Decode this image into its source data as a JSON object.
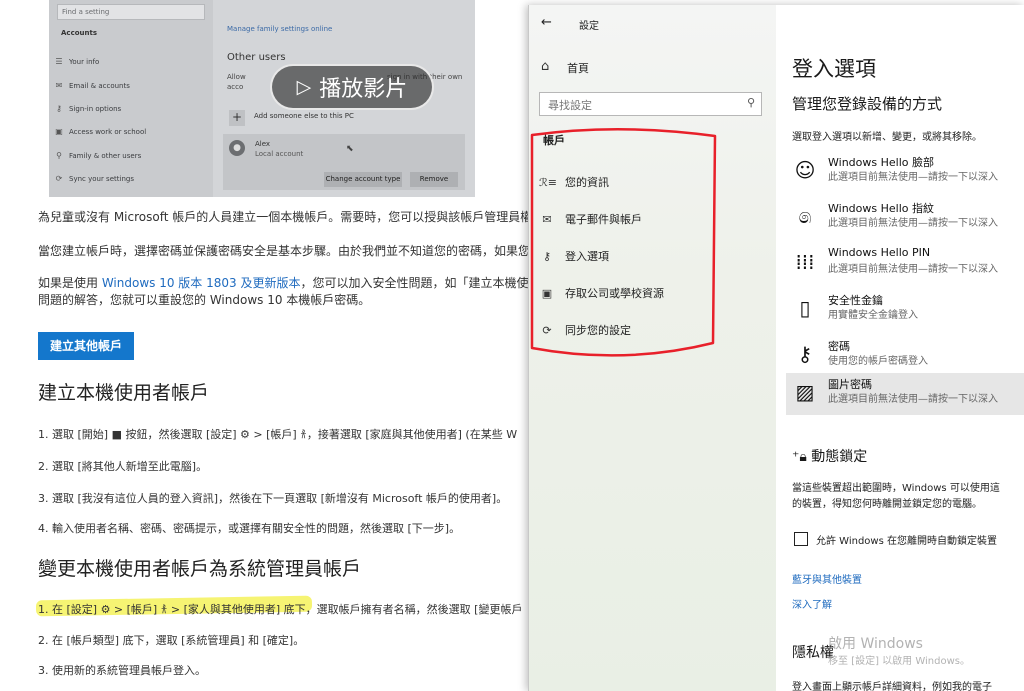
{
  "video": {
    "search_placeholder": "Find a setting",
    "section": "Accounts",
    "nav": [
      {
        "icon": "person-card-icon",
        "label": "Your info"
      },
      {
        "icon": "mail-icon",
        "label": "Email & accounts"
      },
      {
        "icon": "key-icon",
        "label": "Sign-in options"
      },
      {
        "icon": "briefcase-icon",
        "label": "Access work or school"
      },
      {
        "icon": "family-icon",
        "label": "Family & other users"
      },
      {
        "icon": "sync-icon",
        "label": "Sync your settings"
      }
    ],
    "family_link": "Manage family settings online",
    "other_users_heading": "Other users",
    "desc_left": "Allow",
    "desc_left2": "acco",
    "desc_right": "sign in with their own",
    "add_label": "Add someone else to this PC",
    "user_name": "Alex",
    "user_role": "Local account",
    "change_type_btn": "Change account type",
    "remove_btn": "Remove",
    "play_label": "播放影片"
  },
  "article": {
    "p1": "為兒童或沒有 Microsoft 帳戶的人員建立一個本機帳戶。需要時，您可以授與該帳戶管理員權限。",
    "p2": "當您建立帳戶時，選擇密碼並保護密碼安全是基本步驟。由於我們並不知道您的密碼，如果您忘記",
    "p3_pre": "如果是使用 ",
    "p3_link": "Windows 10 版本 1803 及更新版本",
    "p3_post": "，您可以加入安全性問題，如「建立本機使用者帳",
    "p3_line2": "問題的解答，您就可以重設您的 Windows 10 本機帳戶密碼。",
    "create_button": "建立其他帳戶",
    "h_create_local": "建立本機使用者帳戶",
    "steps_create": [
      "1. 選取 [開始] ■ 按鈕，然後選取 [設定] ⚙ > [帳戶] 𐀪，接著選取 [家庭與其他使用者] (在某些 W",
      "2. 選取 [將其他人新增至此電腦]。",
      "3. 選取 [我沒有這位人員的登入資訊]，然後在下一頁選取 [新增沒有 Microsoft 帳戶的使用者]。",
      "4. 輸入使用者名稱、密碼、密碼提示，或選擇有關安全性的問題，然後選取 [下一步]。"
    ],
    "h_change_admin": "變更本機使用者帳戶為系統管理員帳戶",
    "steps_change": [
      "1. 在 [設定] ⚙ > [帳戶] 𐀪 > [家人與其他使用者] 底下，選取帳戶擁有者名稱，然後選取 [變更帳戶",
      "2. 在 [帳戶類型] 底下，選取 [系統管理員] 和 [確定]。",
      "3. 使用新的系統管理員帳戶登入。"
    ]
  },
  "settings": {
    "window_title": "設定",
    "back_icon": "back-arrow-icon",
    "home": "首頁",
    "search_placeholder": "尋找設定",
    "section": "帳戶",
    "nav": [
      {
        "icon": "person-card-icon",
        "label": "您的資訊"
      },
      {
        "icon": "mail-icon",
        "label": "電子郵件與帳戶"
      },
      {
        "icon": "key-icon",
        "label": "登入選項"
      },
      {
        "icon": "briefcase-icon",
        "label": "存取公司或學校資源"
      },
      {
        "icon": "sync-icon",
        "label": "同步您的設定"
      }
    ],
    "annotation_color": "#e8202a",
    "content": {
      "title": "登入選項",
      "subtitle": "管理您登錄設備的方式",
      "hint": "選取登入選項以新增、變更，或將其移除。",
      "options": [
        {
          "icon": "face-icon",
          "name": "Windows Hello 臉部",
          "desc": "此選項目前無法使用—請按一下以深入",
          "selected": false
        },
        {
          "icon": "fingerprint-icon",
          "name": "Windows Hello 指紋",
          "desc": "此選項目前無法使用—請按一下以深入",
          "selected": false
        },
        {
          "icon": "pin-keypad-icon",
          "name": "Windows Hello PIN",
          "desc": "此選項目前無法使用—請按一下以深入",
          "selected": false
        },
        {
          "icon": "security-key-icon",
          "name": "安全性金鑰",
          "desc": "用實體安全金鑰登入",
          "selected": false
        },
        {
          "icon": "password-key-icon",
          "name": "密碼",
          "desc": "使用您的帳戶密碼登入",
          "selected": false
        },
        {
          "icon": "picture-password-icon",
          "name": "圖片密碼",
          "desc": "此選項目前無法使用—請按一下以深入",
          "selected": true
        }
      ],
      "dynamic_lock_title": "動態鎖定",
      "dynamic_lock_desc1": "當這些裝置超出範圍時，Windows 可以使用這",
      "dynamic_lock_desc2": "的裝置，得知您何時離開並鎖定您的電腦。",
      "checkbox_label": "允許 Windows 在您離開時自動鎖定裝置",
      "link_bluetooth": "藍牙與其他裝置",
      "link_learn": "深入了解",
      "privacy_title": "隱私權",
      "watermark1": "啟用 Windows",
      "watermark2": "移至 [設定] 以啟用 Windows。",
      "bottom_text": "登入畫面上顯示帳戶詳細資料，例如我的電子"
    }
  }
}
